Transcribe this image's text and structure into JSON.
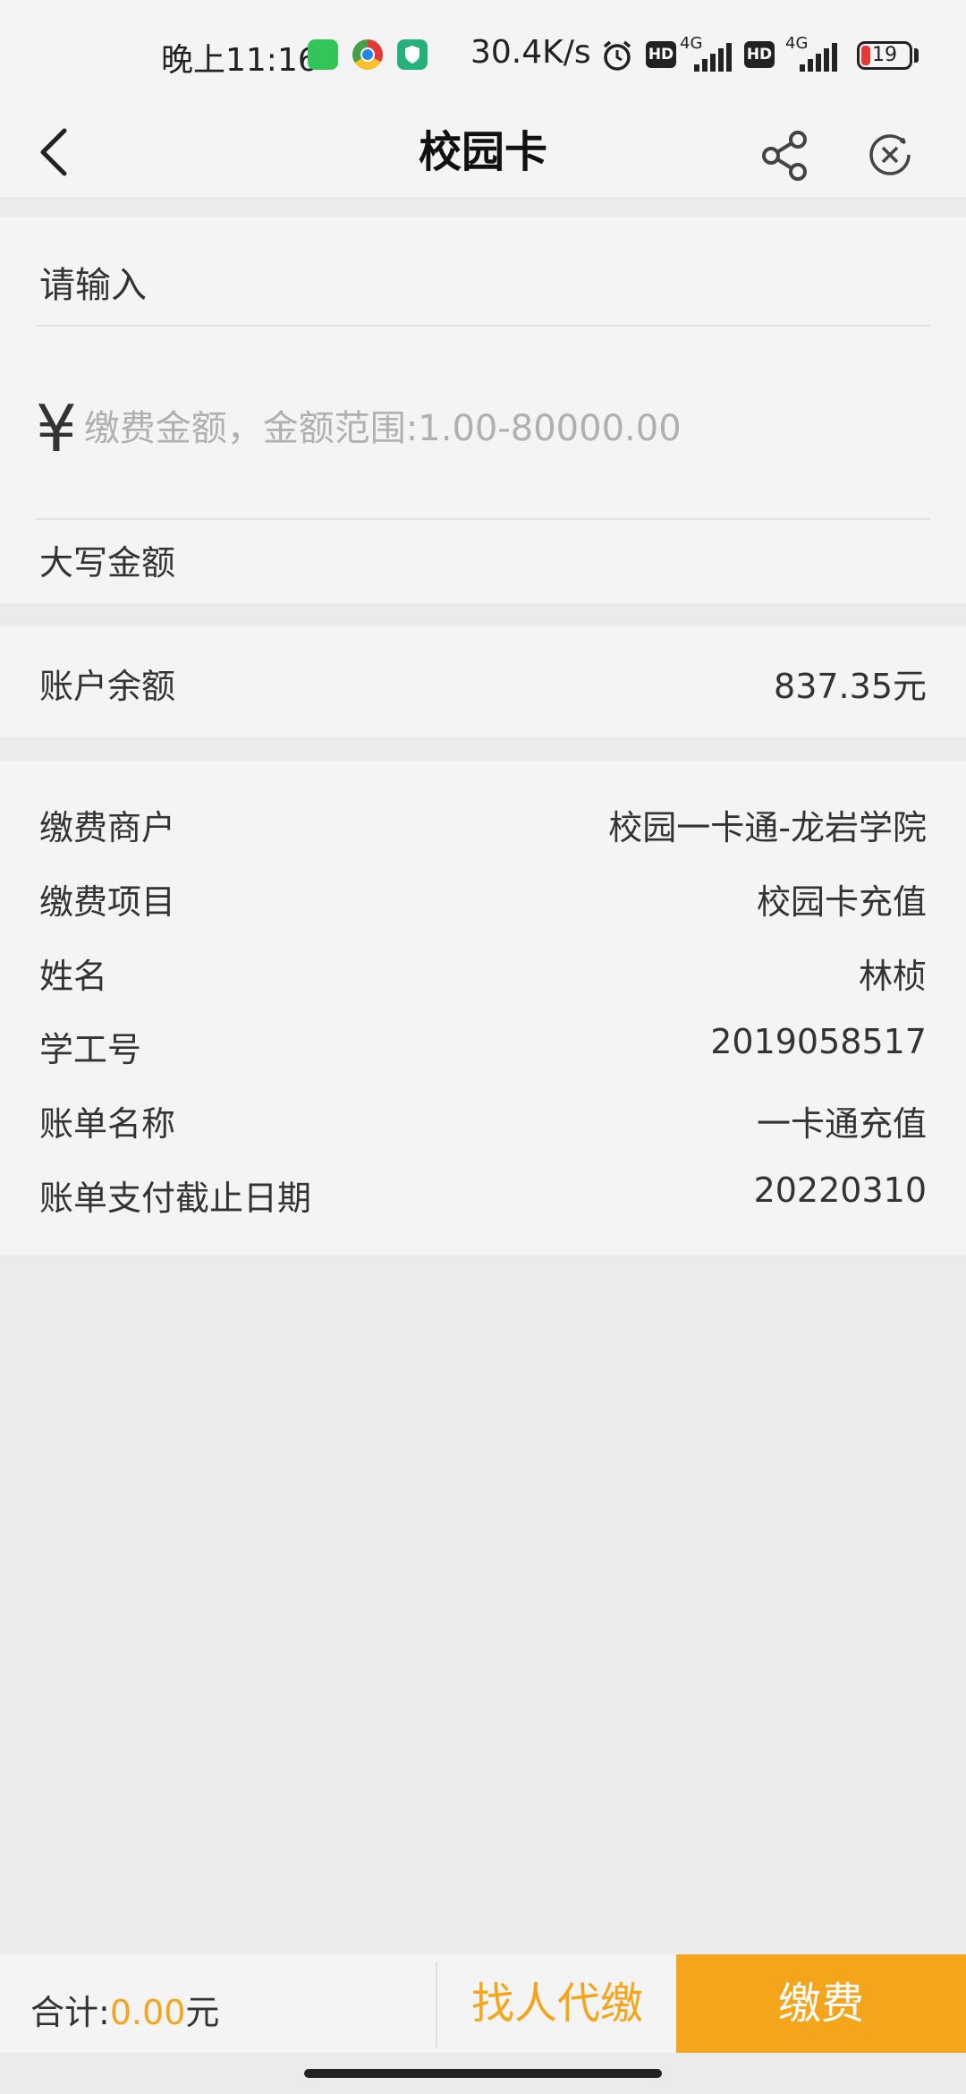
{
  "status_bar": {
    "time": "晚上11:16",
    "network_speed": "30.4K/s",
    "signal_1_label": "4G",
    "signal_2_label": "4G",
    "hd_1": "HD",
    "hd_2": "HD",
    "battery": "19",
    "battery_level": 0.19
  },
  "nav": {
    "title": "校园卡"
  },
  "form": {
    "input_hint": "请输入",
    "currency_symbol": "¥",
    "amount_placeholder": "缴费金额，金额范围:1.00-80000.00",
    "uppercase_label": "大写金额"
  },
  "account": {
    "balance_label": "账户余额",
    "balance_value": "837.35元"
  },
  "details": [
    {
      "label": "缴费商户",
      "value": "校园一卡通-龙岩学院"
    },
    {
      "label": "缴费项目",
      "value": "校园卡充值"
    },
    {
      "label": "姓名",
      "value": "林桢"
    },
    {
      "label": "学工号",
      "value": "2019058517"
    },
    {
      "label": "账单名称",
      "value": "一卡通充值"
    },
    {
      "label": "账单支付截止日期",
      "value": "20220310"
    }
  ],
  "footer": {
    "total_label": "合计:",
    "total_amount": "0.00",
    "total_unit": "元",
    "proxy_pay_label": "找人代缴",
    "pay_label": "缴费"
  },
  "colors": {
    "accent": "#f5a51b",
    "background": "#ebebeb",
    "panel": "#f4f4f4"
  }
}
